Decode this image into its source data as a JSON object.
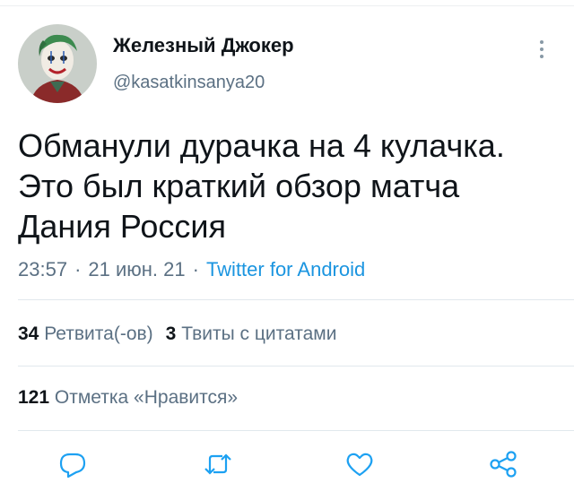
{
  "author": {
    "name": "Железный Джокер",
    "handle": "@kasatkinsanya20"
  },
  "tweet": {
    "text": "Обманули дурачка на 4 кулачка.\nЭто был краткий обзор матча\nДания Россия",
    "time": "23:57",
    "date": "21 июн. 21",
    "separator": "·",
    "source": "Twitter for Android"
  },
  "stats": {
    "retweets_count": "34",
    "retweets_label": "Ретвита(-ов)",
    "quotes_count": "3",
    "quotes_label": "Твиты с цитатами",
    "likes_count": "121",
    "likes_label": "Отметка «Нравится»"
  },
  "colors": {
    "text": "#0f1419",
    "secondary": "#5b7083",
    "link": "#1b95e0",
    "divider": "#e1e8ed",
    "icon": "#1da1f2"
  },
  "actions": [
    "reply-icon",
    "retweet-icon",
    "like-icon",
    "share-icon"
  ]
}
